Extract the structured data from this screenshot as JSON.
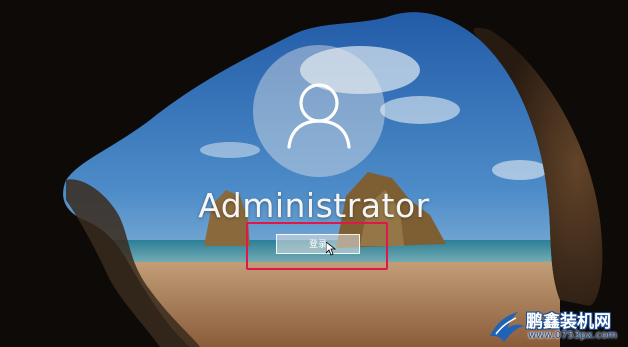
{
  "user": {
    "name": "Administrator"
  },
  "signin": {
    "label": "登录"
  },
  "watermark": {
    "title": "鹏鑫装机网",
    "url": "www.0753px.com"
  },
  "icons": {
    "avatar": "user-silhouette-icon",
    "cursor": "mouse-pointer-icon",
    "logo": "bird-logo-icon"
  },
  "colors": {
    "highlight": "#e0174a",
    "sky": "#3f78b8",
    "sea": "#2f8fa0",
    "sand": "#c08f63",
    "rock": "#1c140e"
  }
}
